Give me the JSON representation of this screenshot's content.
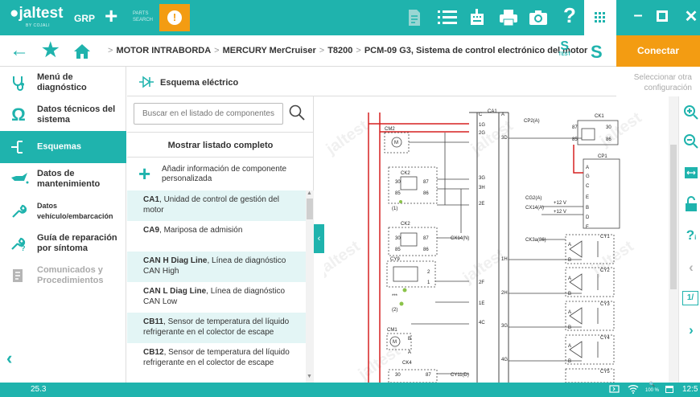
{
  "topbar": {
    "logo": "jaltest",
    "logo_sub": "BY COJALI",
    "grp": "GRP",
    "parts_search": "PARTS SEARCH",
    "alert": "!",
    "help": "?"
  },
  "breadcrumb": {
    "items": [
      "MOTOR INTRABORDA",
      "MERCURY MerCruiser",
      "T8200",
      "PCM-09 G3, Sistema de control electrónico del motor"
    ],
    "separator": ">",
    "test_label": "TEST",
    "connect_label": "Conectar"
  },
  "sidebar": {
    "items": [
      {
        "label": "Menú de diagnóstico",
        "icon": "stethoscope-icon",
        "state": "normal"
      },
      {
        "label": "Datos técnicos del sistema",
        "icon": "omega-icon",
        "state": "normal"
      },
      {
        "label": "Esquemas",
        "icon": "schematic-icon",
        "state": "active"
      },
      {
        "label": "Datos de mantenimiento",
        "icon": "oil-can-icon",
        "state": "normal"
      },
      {
        "label": "Datos vehículo/embarcación",
        "icon": "wrench-icon",
        "state": "normal"
      },
      {
        "label": "Guía de reparación por síntoma",
        "icon": "repair-guide-icon",
        "state": "normal"
      },
      {
        "label": "Comunicados y Procedimientos",
        "icon": "bulletin-icon",
        "state": "disabled"
      }
    ]
  },
  "header": {
    "title": "Esquema eléctrico",
    "select_other": "Seleccionar otra configuración"
  },
  "component_panel": {
    "search_placeholder": "Buscar en el listado de componentes",
    "show_all": "Mostrar listado completo",
    "add_info": "Añadir información de componente personalizada",
    "components": [
      {
        "code": "CA1",
        "desc": "Unidad de control de gestión del motor"
      },
      {
        "code": "CA9",
        "desc": "Mariposa de admisión"
      },
      {
        "code": "CAN H Diag Line",
        "desc": "Línea de diagnóstico CAN High"
      },
      {
        "code": "CAN L Diag Line",
        "desc": "Línea de diagnóstico CAN Low"
      },
      {
        "code": "CB11",
        "desc": "Sensor de temperatura del líquido refrigerante en el colector de escape"
      },
      {
        "code": "CB12",
        "desc": "Sensor de temperatura del líquido refrigerante en el colector de escape"
      }
    ]
  },
  "diagram": {
    "watermark": "jaltest",
    "labels": {
      "c": "C",
      "ca1": "CA1",
      "a": "A",
      "p1g": "1G",
      "p2g": "2G",
      "p3d": "3D",
      "p3g": "3G",
      "p3h": "3H",
      "p2e": "2E",
      "p1h": "1H",
      "p2f": "2F",
      "p1e": "1E",
      "p4c": "4C",
      "p2h": "2H",
      "p3g2": "3G",
      "p4g": "4G",
      "cm2": "CM2",
      "m": "M",
      "ck2": "CK2",
      "ck2b": "CK2",
      "ck4": "CK4",
      "cy9": "CY9",
      "cm1": "CM1",
      "n30": "30",
      "n87": "87",
      "n85": "85",
      "n86": "86",
      "n30b": "30",
      "n87b": "87",
      "n85b": "85",
      "n86b": "86",
      "p1": "(1)",
      "p2": "(2)",
      "stars": "***",
      "cx14n": "CX14(N)",
      "cy11d": "CY11(D)",
      "cp2a": "CP2(A)",
      "cg2a": "CG2(A)",
      "cx14a": "CX14(A)",
      "ck3a": "CK3a(86)",
      "v12a": "+12 V",
      "v12b": "+12 V",
      "ck1": "CK1",
      "cp1": "CP1",
      "cy1": "CY1",
      "cy2": "CY2",
      "cy3": "CY3",
      "cy4": "CY4",
      "cy5": "CY5",
      "k87": "87",
      "k30": "30",
      "k85": "85",
      "k86": "86",
      "la": "A",
      "lg": "G",
      "lc": "C",
      "le": "E",
      "lb": "B",
      "ld": "D",
      "lf": "F",
      "ya": "A",
      "yb": "B",
      "bb": "B",
      "n2": "2",
      "n1": "1",
      "n30c": "30",
      "n87c": "87"
    }
  },
  "status": {
    "version": "25.3",
    "zoom": "100 %",
    "time": "12:5"
  },
  "colors": {
    "accent": "#1fb3ad",
    "warning": "#f39c12",
    "wire_red": "#d62020"
  }
}
